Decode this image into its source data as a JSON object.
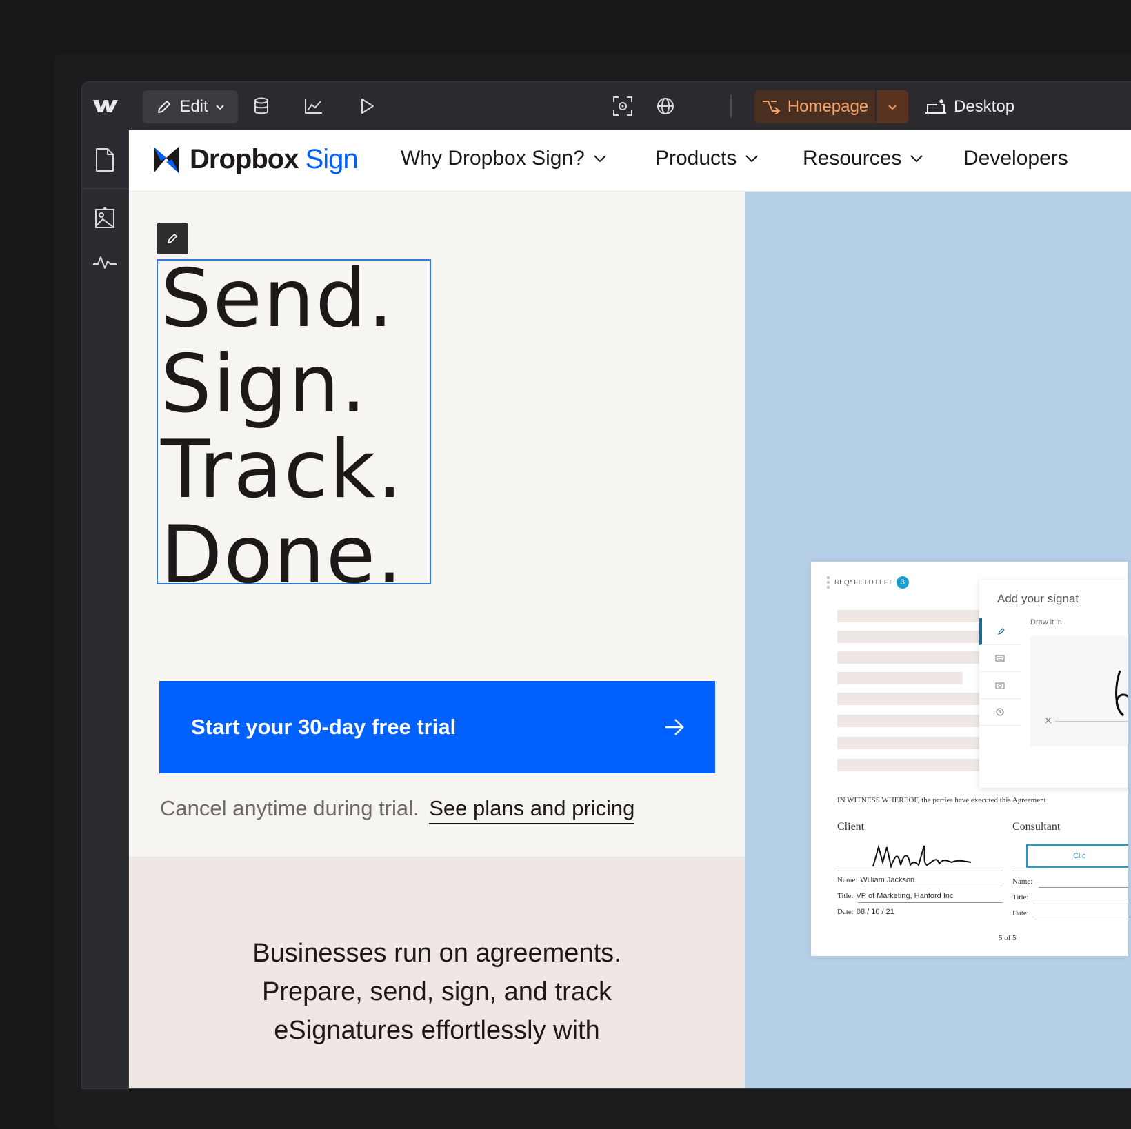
{
  "toolbar": {
    "edit_label": "Edit",
    "homepage_label": "Homepage",
    "desktop_label": "Desktop",
    "accent_color": "#f4a36a"
  },
  "nav": {
    "brand_name": "Dropbox",
    "brand_sign": "Sign",
    "items": [
      {
        "label": "Why Dropbox Sign?"
      },
      {
        "label": "Products"
      },
      {
        "label": "Resources"
      },
      {
        "label": "Developers"
      }
    ]
  },
  "hero": {
    "headline": [
      "Send.",
      "Sign.",
      "Track.",
      "Done."
    ],
    "cta_label": "Start your 30-day free trial",
    "cancel_text": "Cancel anytime during trial.",
    "pricing_link": "See plans and pricing",
    "cta_color": "#0061fe"
  },
  "body_copy": [
    "Businesses run on agreements.",
    "Prepare, send, sign, and track",
    "eSignatures effortlessly with"
  ],
  "doc": {
    "req_label": "REQ* FIELD LEFT",
    "req_count": "3",
    "sig_title": "Add your signat",
    "draw_label": "Draw it in",
    "witness": "IN WITNESS WHEREOF, the parties have executed this Agreement",
    "client": "Client",
    "consultant": "Consultant",
    "name_label": "Name:",
    "name_value": "William Jackson",
    "title_label": "Title:",
    "title_value": "VP of Marketing, Hanford Inc",
    "date_label": "Date:",
    "date_value": "08   / 10   / 21",
    "click_label": "Clic",
    "page_no": "5 of 5"
  }
}
